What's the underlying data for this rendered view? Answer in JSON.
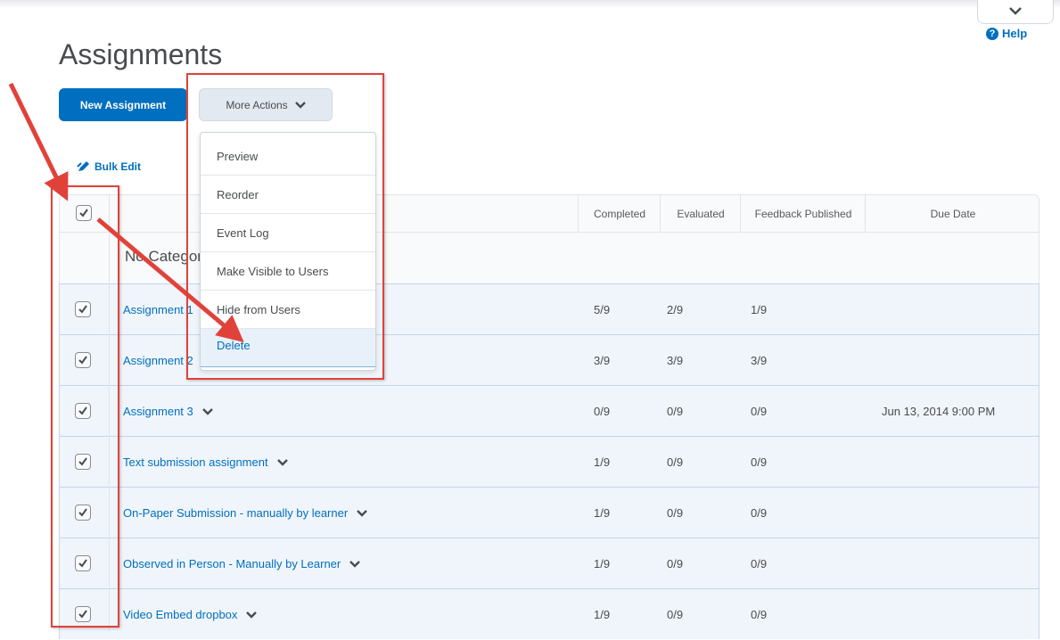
{
  "page": {
    "title": "Assignments",
    "help_label": "Help"
  },
  "toolbar": {
    "new_assignment_label": "New Assignment",
    "more_actions_label": "More Actions",
    "bulk_edit_label": "Bulk Edit"
  },
  "more_actions_menu": {
    "items": [
      {
        "label": "Preview"
      },
      {
        "label": "Reorder"
      },
      {
        "label": "Event Log"
      },
      {
        "label": "Make Visible to Users"
      },
      {
        "label": "Hide from Users"
      },
      {
        "label": "Delete",
        "highlighted": true
      }
    ]
  },
  "table": {
    "columns": [
      "Completed",
      "Evaluated",
      "Feedback Published",
      "Due Date"
    ],
    "category_label": "No Category",
    "select_all_checked": true,
    "rows": [
      {
        "name": "Assignment 1",
        "completed": "5/9",
        "evaluated": "2/9",
        "feedback": "1/9",
        "due": "",
        "checked": true
      },
      {
        "name": "Assignment 2",
        "completed": "3/9",
        "evaluated": "3/9",
        "feedback": "3/9",
        "due": "",
        "checked": true
      },
      {
        "name": "Assignment 3",
        "completed": "0/9",
        "evaluated": "0/9",
        "feedback": "0/9",
        "due": "Jun 13, 2014 9:00 PM",
        "checked": true
      },
      {
        "name": "Text submission assignment",
        "completed": "1/9",
        "evaluated": "0/9",
        "feedback": "0/9",
        "due": "",
        "checked": true
      },
      {
        "name": "On-Paper Submission - manually by learner",
        "completed": "1/9",
        "evaluated": "0/9",
        "feedback": "0/9",
        "due": "",
        "checked": true
      },
      {
        "name": "Observed in Person - Manually by Learner",
        "completed": "1/9",
        "evaluated": "0/9",
        "feedback": "0/9",
        "due": "",
        "checked": true
      },
      {
        "name": "Video Embed dropbox",
        "completed": "1/9",
        "evaluated": "0/9",
        "feedback": "0/9",
        "due": "",
        "checked": true
      }
    ]
  },
  "colors": {
    "primary": "#006fbf",
    "annotation_red": "#e0423a",
    "selected_row": "#f0f5fb"
  }
}
